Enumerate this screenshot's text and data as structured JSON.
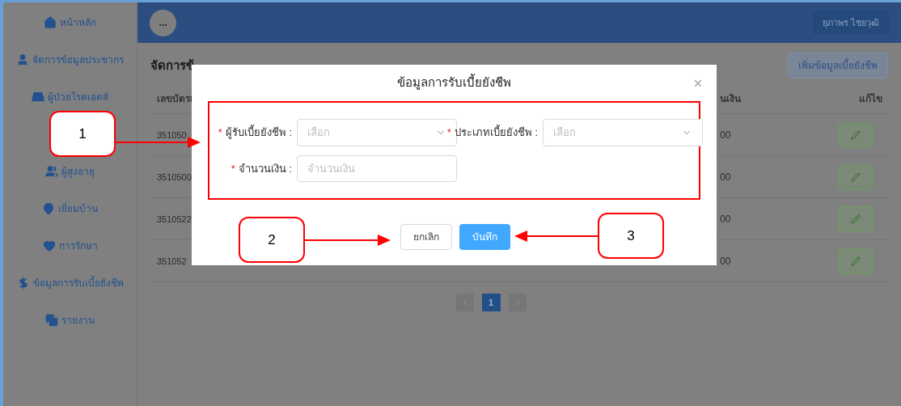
{
  "sidebar": {
    "items": [
      {
        "label": "หน้าหลัก"
      },
      {
        "label": "จัดการข้อมูลประชากร"
      },
      {
        "label": "ผู้ป่วยโรคเอดส์"
      },
      {
        "label": "ผู้สูงอายุ"
      },
      {
        "label": "เยี่ยมบ้าน"
      },
      {
        "label": "การรักษา"
      },
      {
        "label": "ข้อมูลการรับเบี้ยยังชีพ"
      },
      {
        "label": "รายงาน"
      }
    ]
  },
  "header": {
    "menu_button": "...",
    "user": "ยุภาพร ไชยวุฒิ"
  },
  "page": {
    "title": "จัดการข้",
    "add_button": "เพิ่มข้อมูลเบี้ยยังชีพ",
    "table": {
      "columns": [
        "เลขบัตรเ",
        "นเงิน",
        "แก้ไข"
      ],
      "rows": [
        {
          "id": "351050",
          "amount": "00"
        },
        {
          "id": "3510500",
          "amount": "00"
        },
        {
          "id": "3510522",
          "amount": "00"
        },
        {
          "id": "351052",
          "amount": "00"
        }
      ]
    },
    "pagination": {
      "pages": [
        {
          "label": "1",
          "selected": true
        }
      ]
    }
  },
  "modal": {
    "title": "ข้อมูลการรับเบี้ยยังชีพ",
    "fields": [
      {
        "kind": "select",
        "required_mark": "*",
        "label": "ผู้รับเบี้ยยังชีพ :",
        "placeholder": "เลือก"
      },
      {
        "kind": "select",
        "required_mark": "*",
        "label": "ประเภทเบี้ยยังชีพ :",
        "placeholder": "เลือก"
      },
      {
        "kind": "input",
        "required_mark": "*",
        "label": "จำนวนเงิน :",
        "placeholder": "จำนวนเงิน"
      }
    ],
    "buttons": [
      {
        "kind": "default",
        "label": "ยกเลิก"
      },
      {
        "kind": "primary",
        "label": "บันทึก"
      }
    ]
  },
  "annotations": [
    {
      "label": "1"
    },
    {
      "label": "2"
    },
    {
      "label": "3"
    }
  ]
}
